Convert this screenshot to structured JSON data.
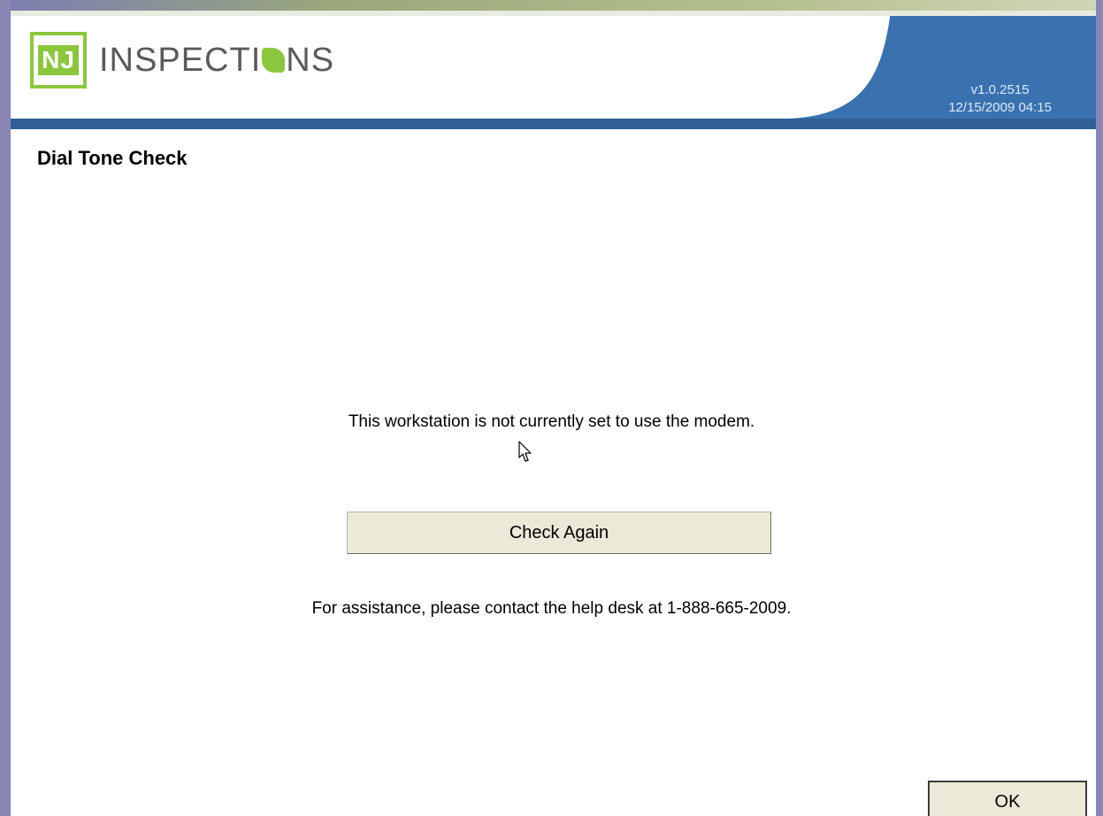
{
  "header": {
    "logo_prefix": "NJ",
    "logo_word_start": "INSPECTI",
    "logo_word_end": "NS",
    "version": "v1.0.2515",
    "datetime": "12/15/2009 04:15",
    "colors": {
      "brand_green": "#8cc63f",
      "header_blue": "#3a72b0",
      "frame_purple": "#8a86b4"
    }
  },
  "page": {
    "title": "Dial Tone Check",
    "message": "This workstation is not currently set to use the modem.",
    "check_again_label": "Check Again",
    "help_text": "For assistance, please contact the help desk at 1-888-665-2009.",
    "ok_label": "OK"
  },
  "icons": {
    "logo_leaf": "leaf-icon",
    "cursor": "mouse-pointer-icon"
  }
}
